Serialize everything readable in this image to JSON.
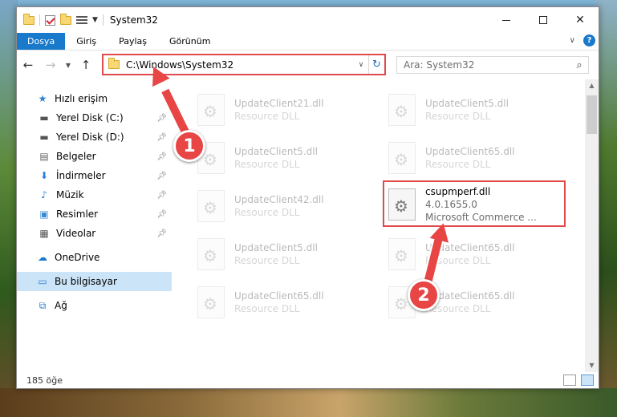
{
  "window": {
    "title": "System32",
    "minimize": "─",
    "close": "✕"
  },
  "ribbon": {
    "tabs": [
      "Dosya",
      "Giriş",
      "Paylaş",
      "Görünüm"
    ],
    "help": "?"
  },
  "nav": {
    "address": "C:\\Windows\\System32",
    "search_placeholder": "Ara: System32"
  },
  "sidebar": {
    "quick_access": "Hızlı erişim",
    "items": [
      {
        "label": "Yerel Disk (C:)",
        "icon": "drive-icon",
        "pinned": true
      },
      {
        "label": "Yerel Disk (D:)",
        "icon": "drive-icon",
        "pinned": true
      },
      {
        "label": "Belgeler",
        "icon": "documents-icon",
        "pinned": true
      },
      {
        "label": "İndirmeler",
        "icon": "download-icon",
        "pinned": true
      },
      {
        "label": "Müzik",
        "icon": "music-icon",
        "pinned": true
      },
      {
        "label": "Resimler",
        "icon": "pictures-icon",
        "pinned": true
      },
      {
        "label": "Videolar",
        "icon": "videos-icon",
        "pinned": true
      }
    ],
    "onedrive": "OneDrive",
    "this_pc": "Bu bilgisayar",
    "network": "Ağ"
  },
  "files": [
    {
      "name": "UpdateClient21.dll",
      "sub": "Resource DLL"
    },
    {
      "name": "UpdateClient5.dll",
      "sub": "Resource DLL"
    },
    {
      "name": "UpdateClient5.dll",
      "sub": "Resource DLL"
    },
    {
      "name": "UpdateClient65.dll",
      "sub": "Resource DLL"
    },
    {
      "name": "UpdateClient42.dll",
      "sub": "Resource DLL"
    },
    {
      "name": "csupmperf.dll",
      "sub": "4.0.1655.0",
      "sub2": "Microsoft Commerce ..."
    },
    {
      "name": "UpdateClient5.dll",
      "sub": "Resource DLL"
    },
    {
      "name": "UpdateClient65.dll",
      "sub": "Resource DLL"
    },
    {
      "name": "UpdateClient65.dll",
      "sub": "Resource DLL"
    },
    {
      "name": "UpdateClient65.dll",
      "sub": "Resource DLL"
    }
  ],
  "status": {
    "count": "185 öğe"
  },
  "annotations": {
    "step1": "1",
    "step2": "2",
    "color": "#e84545"
  }
}
